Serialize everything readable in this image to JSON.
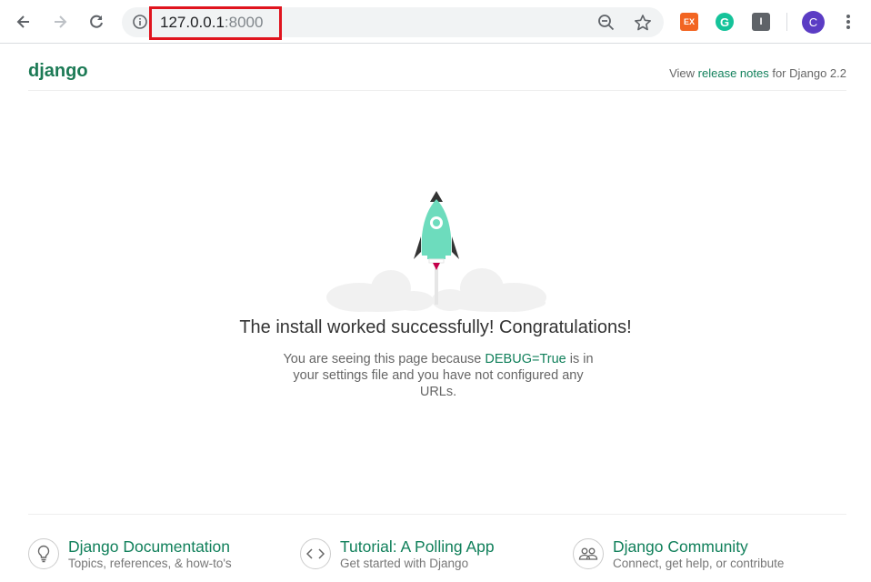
{
  "browser": {
    "url_host": "127.0.0.1",
    "url_port": ":8000",
    "avatar_letter": "C",
    "extensions": [
      {
        "name": "ex-extension",
        "label": "EX",
        "color": "#f26522"
      },
      {
        "name": "grammarly-extension",
        "label": "G",
        "color": "#15c39a"
      },
      {
        "name": "dark-extension",
        "label": "I",
        "color": "#5f6368"
      }
    ]
  },
  "header": {
    "logo": "django",
    "release_prefix": "View ",
    "release_link": "release notes",
    "release_suffix": " for Django 2.2"
  },
  "main": {
    "headline": "The install worked successfully! Congratulations!",
    "sub_prefix": "You are seeing this page because ",
    "sub_debug": "DEBUG=True",
    "sub_suffix": " is in your settings file and you have not configured any URLs."
  },
  "footer": {
    "cards": [
      {
        "icon": "lightbulb-icon",
        "title": "Django Documentation",
        "subtitle": "Topics, references, & how-to's"
      },
      {
        "icon": "code-icon",
        "title": "Tutorial: A Polling App",
        "subtitle": "Get started with Django"
      },
      {
        "icon": "people-icon",
        "title": "Django Community",
        "subtitle": "Connect, get help, or contribute"
      }
    ]
  },
  "colors": {
    "accent": "#11805b",
    "highlight": "#e0141e",
    "rocket": "#6ddcbd"
  }
}
